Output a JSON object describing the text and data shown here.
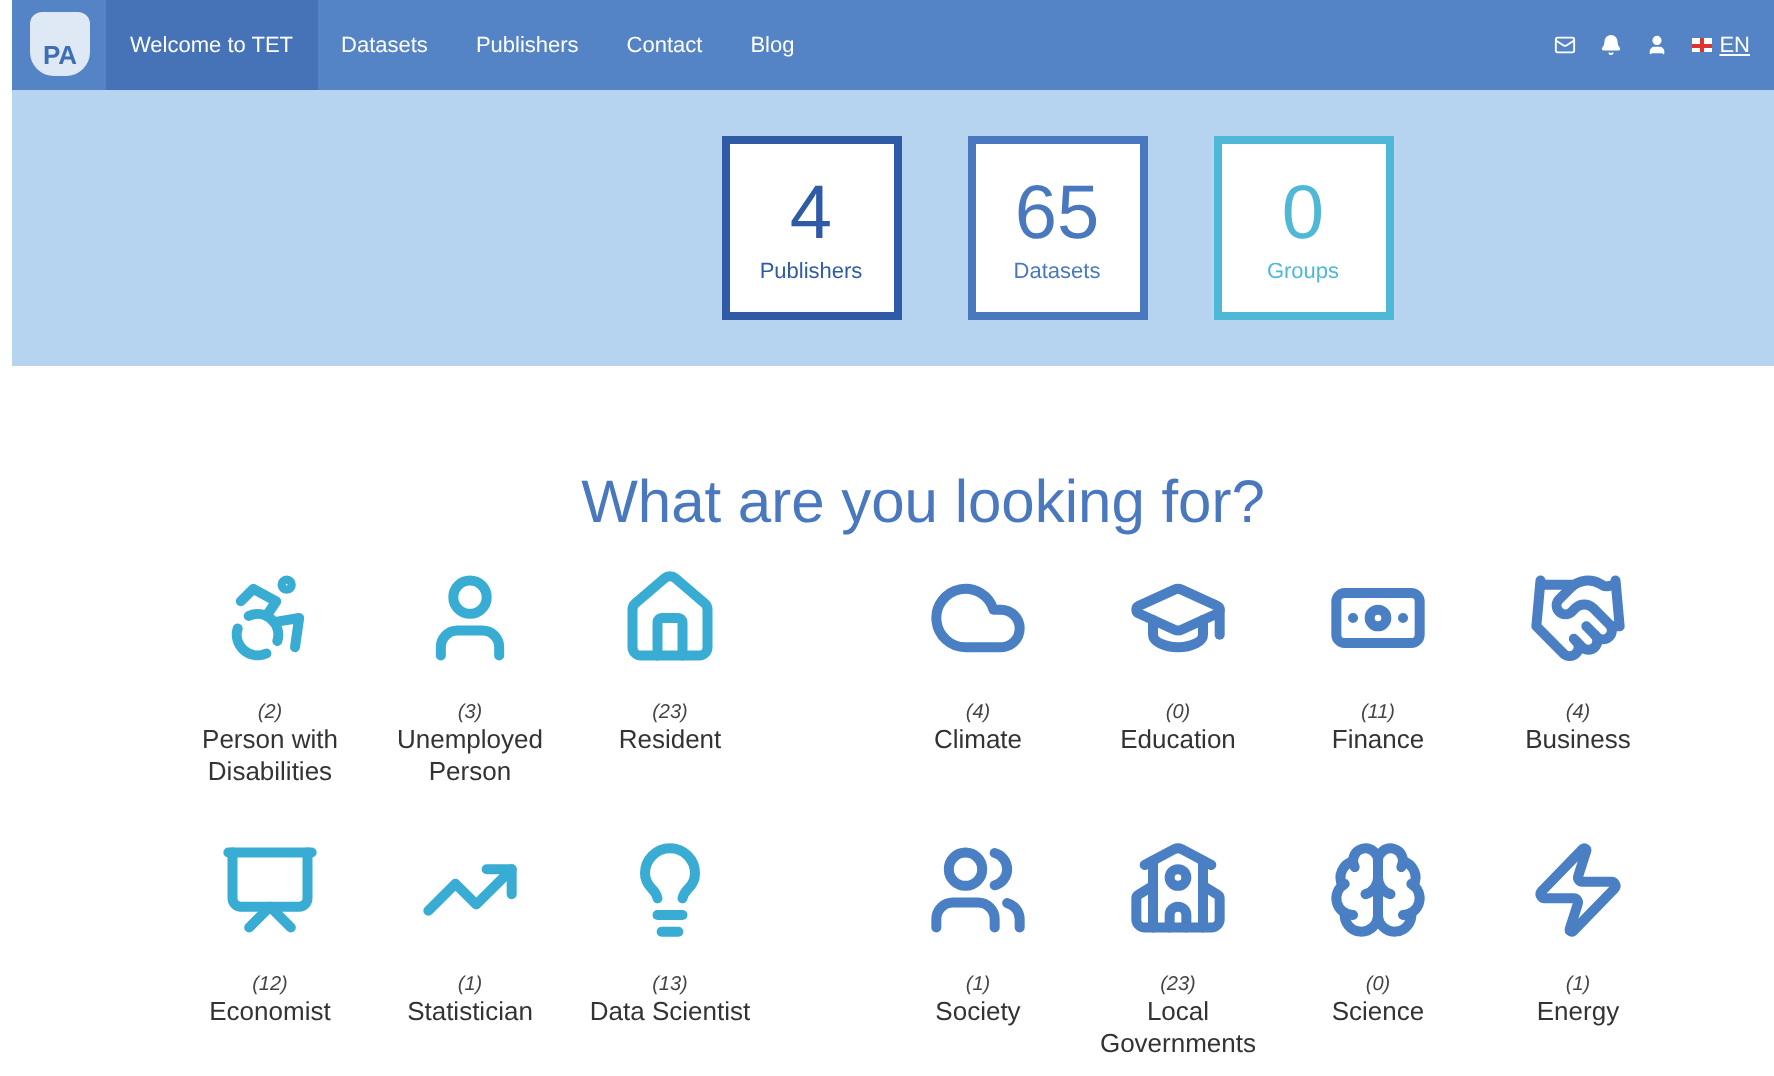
{
  "nav": {
    "logo_text": "PA",
    "items": [
      {
        "label": "Welcome to TET",
        "selected": true
      },
      {
        "label": "Datasets",
        "selected": false
      },
      {
        "label": "Publishers",
        "selected": false
      },
      {
        "label": "Contact",
        "selected": false
      },
      {
        "label": "Blog",
        "selected": false
      }
    ],
    "language": "EN"
  },
  "stats": [
    {
      "value": "4",
      "label": "Publishers",
      "color": "#2f5aa5"
    },
    {
      "value": "65",
      "label": "Datasets",
      "color": "#4a78bf"
    },
    {
      "value": "0",
      "label": "Groups",
      "color": "#4fb8d6"
    }
  ],
  "heading": "What are you looking for?",
  "audiences": [
    {
      "kind": "wheelchair",
      "count": "(2)",
      "label": "Person with Disabilities"
    },
    {
      "kind": "person",
      "count": "(3)",
      "label": "Unemployed Person"
    },
    {
      "kind": "family",
      "count": "(23)",
      "label": "Resident"
    },
    {
      "kind": "presenter",
      "count": "(12)",
      "label": "Economist"
    },
    {
      "kind": "board",
      "count": "(1)",
      "label": "Statistician"
    },
    {
      "kind": "idea",
      "count": "(13)",
      "label": "Data Scientist"
    }
  ],
  "topics": [
    {
      "kind": "cloud",
      "count": "(4)",
      "label": "Climate"
    },
    {
      "kind": "cap",
      "count": "(0)",
      "label": "Education"
    },
    {
      "kind": "money",
      "count": "(11)",
      "label": "Finance"
    },
    {
      "kind": "handshake",
      "count": "(4)",
      "label": "Business"
    },
    {
      "kind": "people",
      "count": "(1)",
      "label": "Society"
    },
    {
      "kind": "school",
      "count": "(23)",
      "label": "Local Governments"
    },
    {
      "kind": "head",
      "count": "(0)",
      "label": "Science"
    },
    {
      "kind": "bolt",
      "count": "(1)",
      "label": "Energy"
    }
  ]
}
